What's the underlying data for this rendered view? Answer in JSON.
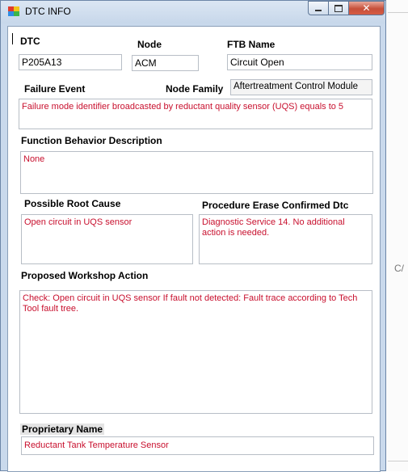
{
  "window": {
    "title": "DTC INFO"
  },
  "background": {
    "side_text": "C/"
  },
  "fields": {
    "dtc": {
      "label": "DTC",
      "value": "P205A13"
    },
    "node": {
      "label": "Node",
      "value": "ACM"
    },
    "ftb_name": {
      "label": "FTB Name",
      "value": "Circuit Open"
    },
    "failure_event": {
      "label": "Failure Event",
      "value": "Failure mode identifier broadcasted by reductant quality sensor (UQS) equals to 5"
    },
    "node_family": {
      "label": "Node Family",
      "value": "Aftertreatment Control Module"
    },
    "function_behavior": {
      "label": "Function Behavior Description",
      "value": "None"
    },
    "possible_root_cause": {
      "label": "Possible Root Cause",
      "value": "Open circuit in UQS sensor"
    },
    "procedure_erase": {
      "label": "Procedure Erase Confirmed Dtc",
      "value": "Diagnostic Service 14. No additional action is needed."
    },
    "proposed_workshop_action": {
      "label": "Proposed Workshop Action",
      "value": "Check: Open circuit in UQS sensor If fault not detected: Fault trace according to Tech Tool fault tree."
    },
    "proprietary_name": {
      "label": "Proprietary Name",
      "value": "Reductant Tank Temperature Sensor"
    }
  },
  "colors": {
    "value_text": "#c8102e",
    "title_bar": "#c9d9ec",
    "close_button": "#c7503a"
  }
}
